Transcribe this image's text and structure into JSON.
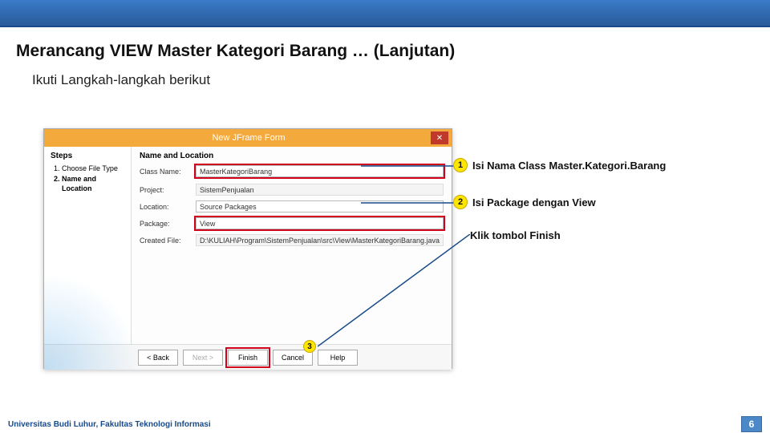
{
  "slide": {
    "title": "Merancang VIEW Master Kategori Barang … (Lanjutan)",
    "subtitle": "Ikuti Langkah-langkah berikut"
  },
  "dialog": {
    "title": "New JFrame Form",
    "steps_header": "Steps",
    "steps": [
      "Choose File Type",
      "Name and Location"
    ],
    "form_header": "Name and Location",
    "rows": {
      "class_name": {
        "label": "Class Name:",
        "value": "MasterKategoriBarang"
      },
      "project": {
        "label": "Project:",
        "value": "SistemPenjualan"
      },
      "location": {
        "label": "Location:",
        "value": "Source Packages"
      },
      "package": {
        "label": "Package:",
        "value": "View"
      },
      "created": {
        "label": "Created File:",
        "value": "D:\\KULIAH\\Program\\SistemPenjualan\\src\\View\\MasterKategoriBarang.java"
      }
    },
    "buttons": {
      "back": "< Back",
      "next": "Next >",
      "finish": "Finish",
      "cancel": "Cancel",
      "help": "Help"
    }
  },
  "callouts": {
    "c1": "Isi Nama Class Master.Kategori.Barang",
    "c2": "Isi Package dengan View",
    "c3": "Klik tombol Finish",
    "n1": "1",
    "n2": "2",
    "n3": "3"
  },
  "footer": {
    "org": "Universitas Budi Luhur, Fakultas Teknologi Informasi",
    "page": "6"
  }
}
